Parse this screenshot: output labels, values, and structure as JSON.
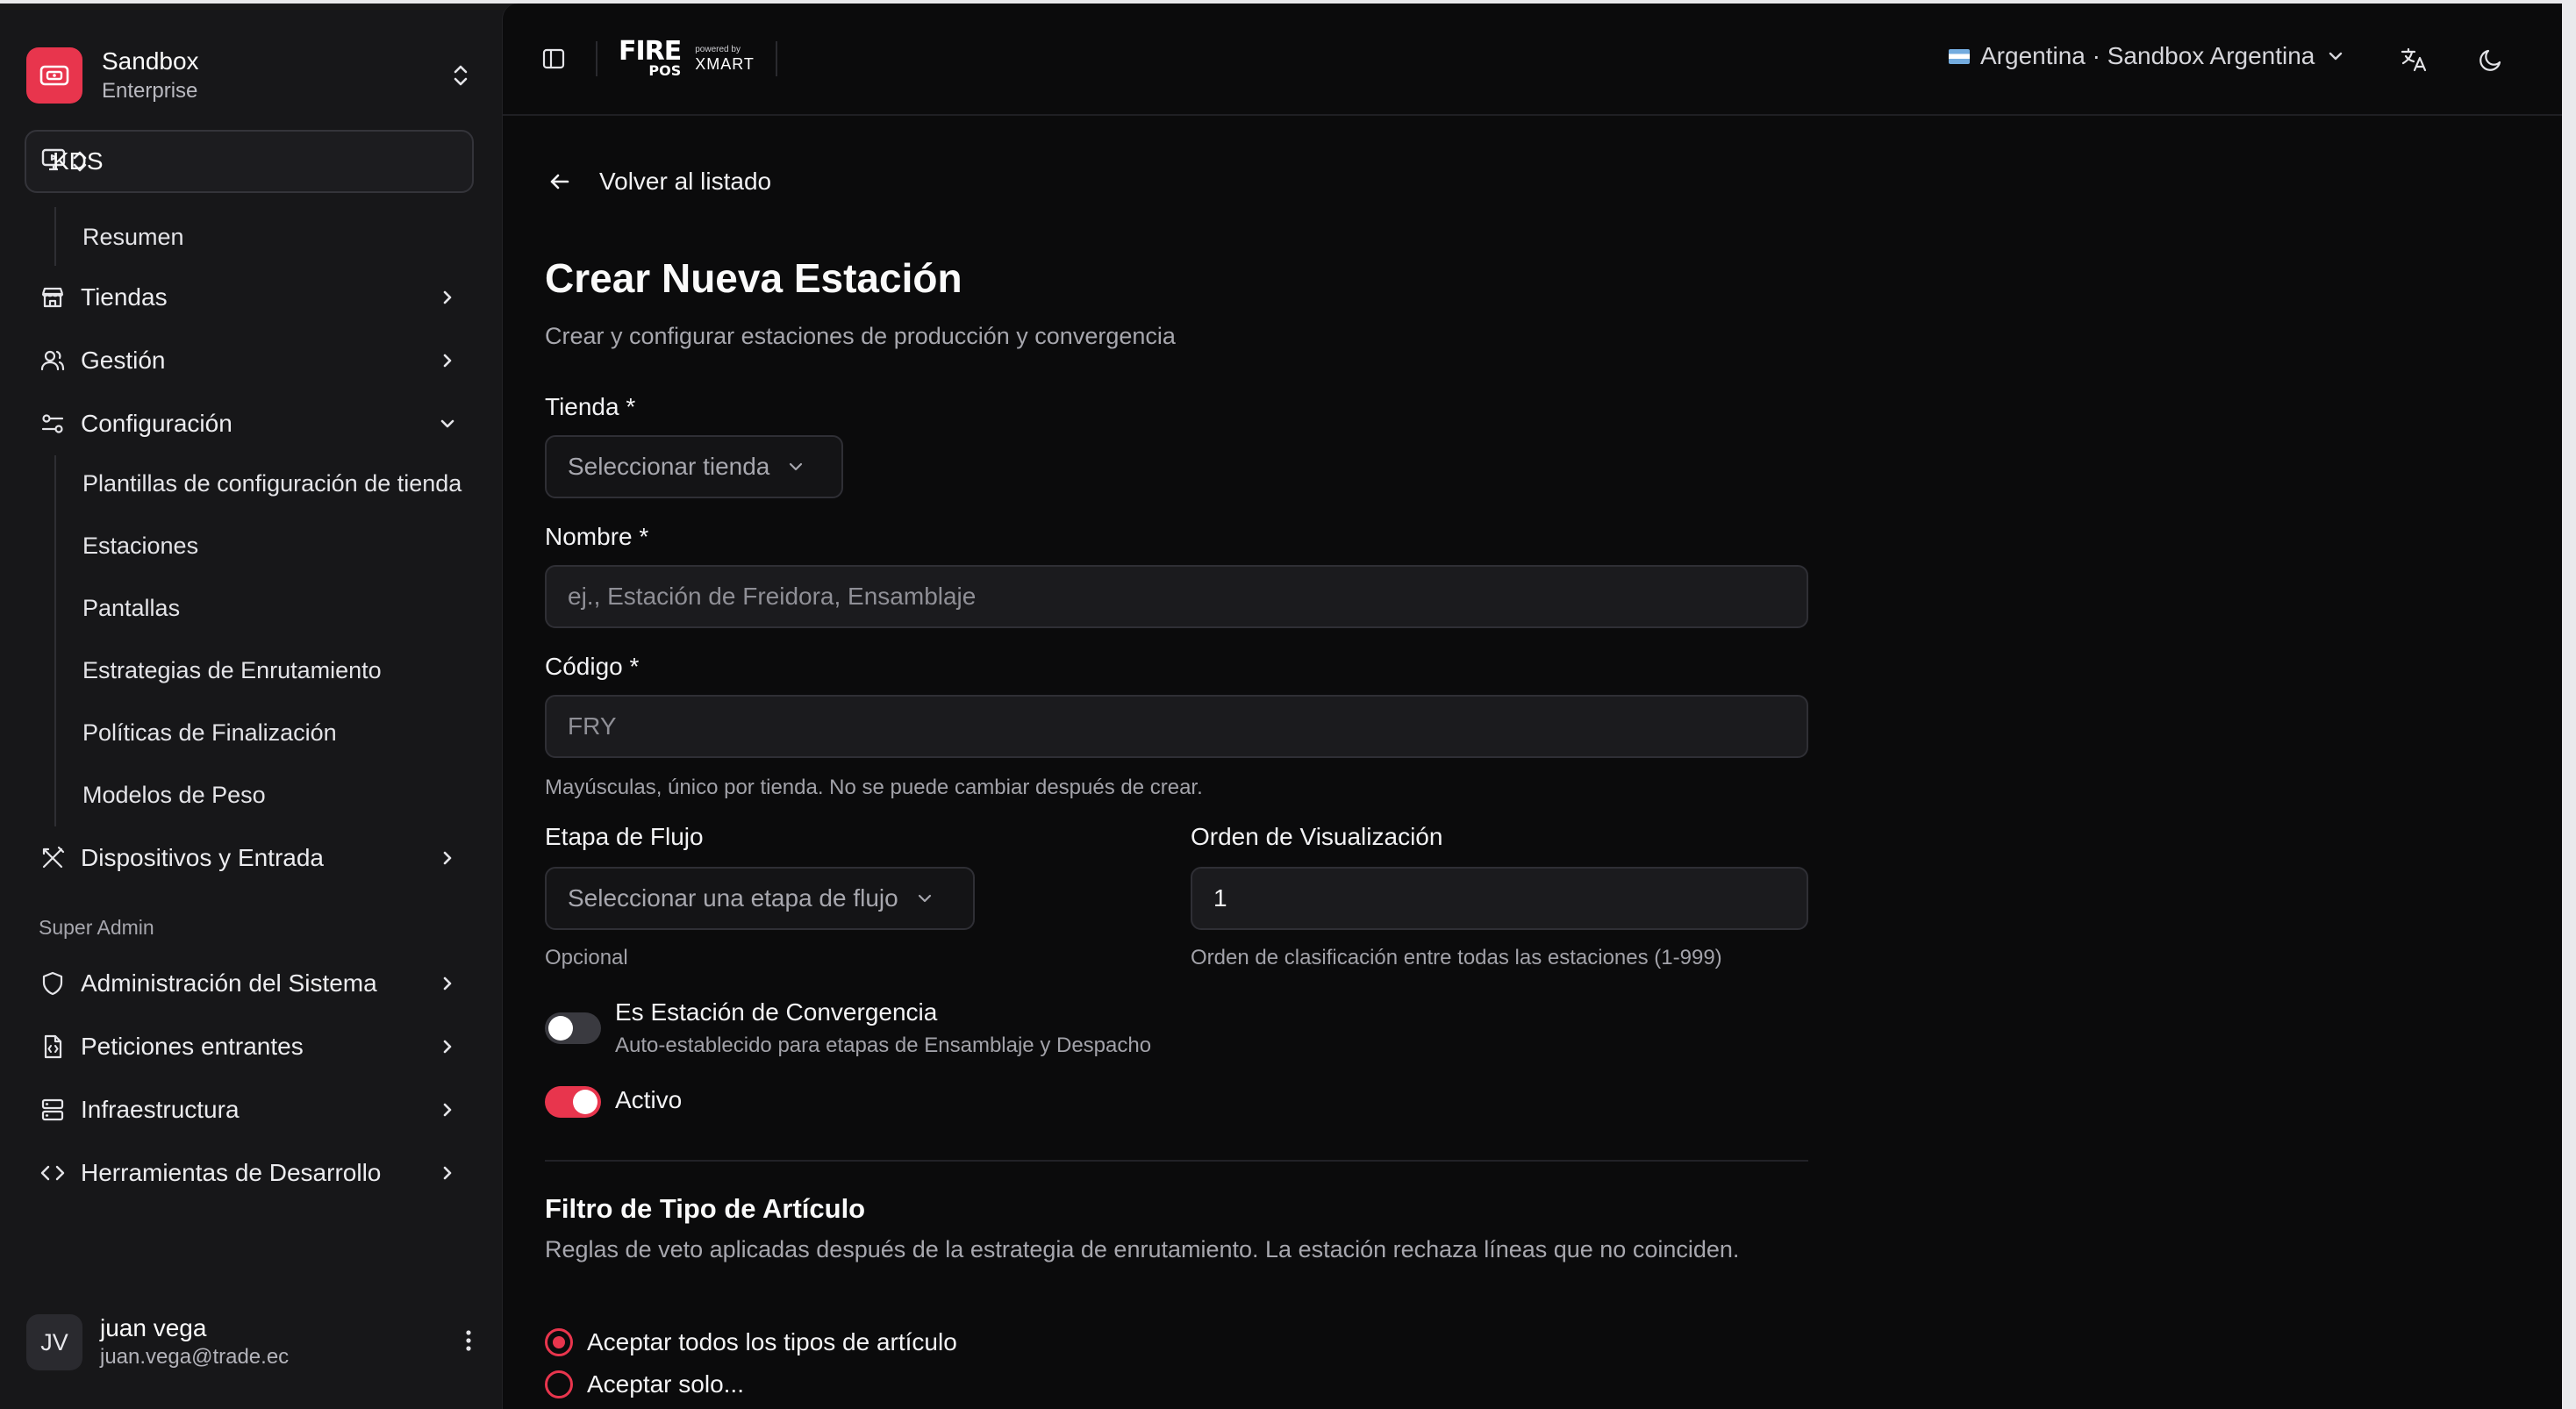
{
  "org": {
    "name": "Sandbox",
    "plan": "Enterprise"
  },
  "app_switcher": {
    "label": "KDS"
  },
  "sidebar": {
    "summary": "Resumen",
    "items": [
      {
        "label": "Tiendas",
        "icon": "store-icon"
      },
      {
        "label": "Gestión",
        "icon": "users-icon"
      },
      {
        "label": "Configuración",
        "icon": "settings-sliders-icon",
        "expanded": true
      }
    ],
    "config_sub": [
      "Plantillas de configuración de tienda",
      "Estaciones",
      "Pantallas",
      "Estrategias de Enrutamiento",
      "Políticas de Finalización",
      "Modelos de Peso"
    ],
    "devices": {
      "label": "Dispositivos y Entrada",
      "icon": "utensils-icon"
    },
    "super_admin_label": "Super Admin",
    "admin_items": [
      {
        "label": "Administración del Sistema",
        "icon": "shield-icon"
      },
      {
        "label": "Peticiones entrantes",
        "icon": "file-code-icon"
      },
      {
        "label": "Infraestructura",
        "icon": "server-icon"
      },
      {
        "label": "Herramientas de Desarrollo",
        "icon": "code-icon"
      }
    ]
  },
  "user": {
    "initials": "JV",
    "name": "juan vega",
    "email": "juan.vega@trade.ec"
  },
  "header": {
    "brand_fire": "FIRE",
    "brand_pos": "POS",
    "brand_powered": "powered by",
    "brand_partner": "XMART",
    "country": "Argentina · Sandbox Argentina"
  },
  "page": {
    "back": "Volver al listado",
    "title": "Crear Nueva Estación",
    "subtitle": "Crear y configurar estaciones de producción y convergencia"
  },
  "form": {
    "store_label": "Tienda *",
    "store_placeholder": "Seleccionar tienda",
    "name_label": "Nombre *",
    "name_placeholder": "ej., Estación de Freidora, Ensamblaje",
    "code_label": "Código *",
    "code_placeholder": "FRY",
    "code_help": "Mayúsculas, único por tienda. No se puede cambiar después de crear.",
    "stage_label": "Etapa de Flujo",
    "stage_placeholder": "Seleccionar una etapa de flujo",
    "stage_help": "Opcional",
    "order_label": "Orden de Visualización",
    "order_value": "1",
    "order_help": "Orden de clasificación entre todas las estaciones (1-999)",
    "convergence_label": "Es Estación de Convergencia",
    "convergence_desc": "Auto-establecido para etapas de Ensamblaje y Despacho",
    "convergence_on": false,
    "active_label": "Activo",
    "active_on": true
  },
  "filter": {
    "title": "Filtro de Tipo de Artículo",
    "desc": "Reglas de veto aplicadas después de la estrategia de enrutamiento. La estación rechaza líneas que no coinciden.",
    "option_all": "Aceptar todos los tipos de artículo",
    "option_only": "Aceptar solo...",
    "selected": "all"
  },
  "colors": {
    "accent": "#e8354d",
    "background": "#0b0b0c",
    "sidebar": "#171719"
  }
}
